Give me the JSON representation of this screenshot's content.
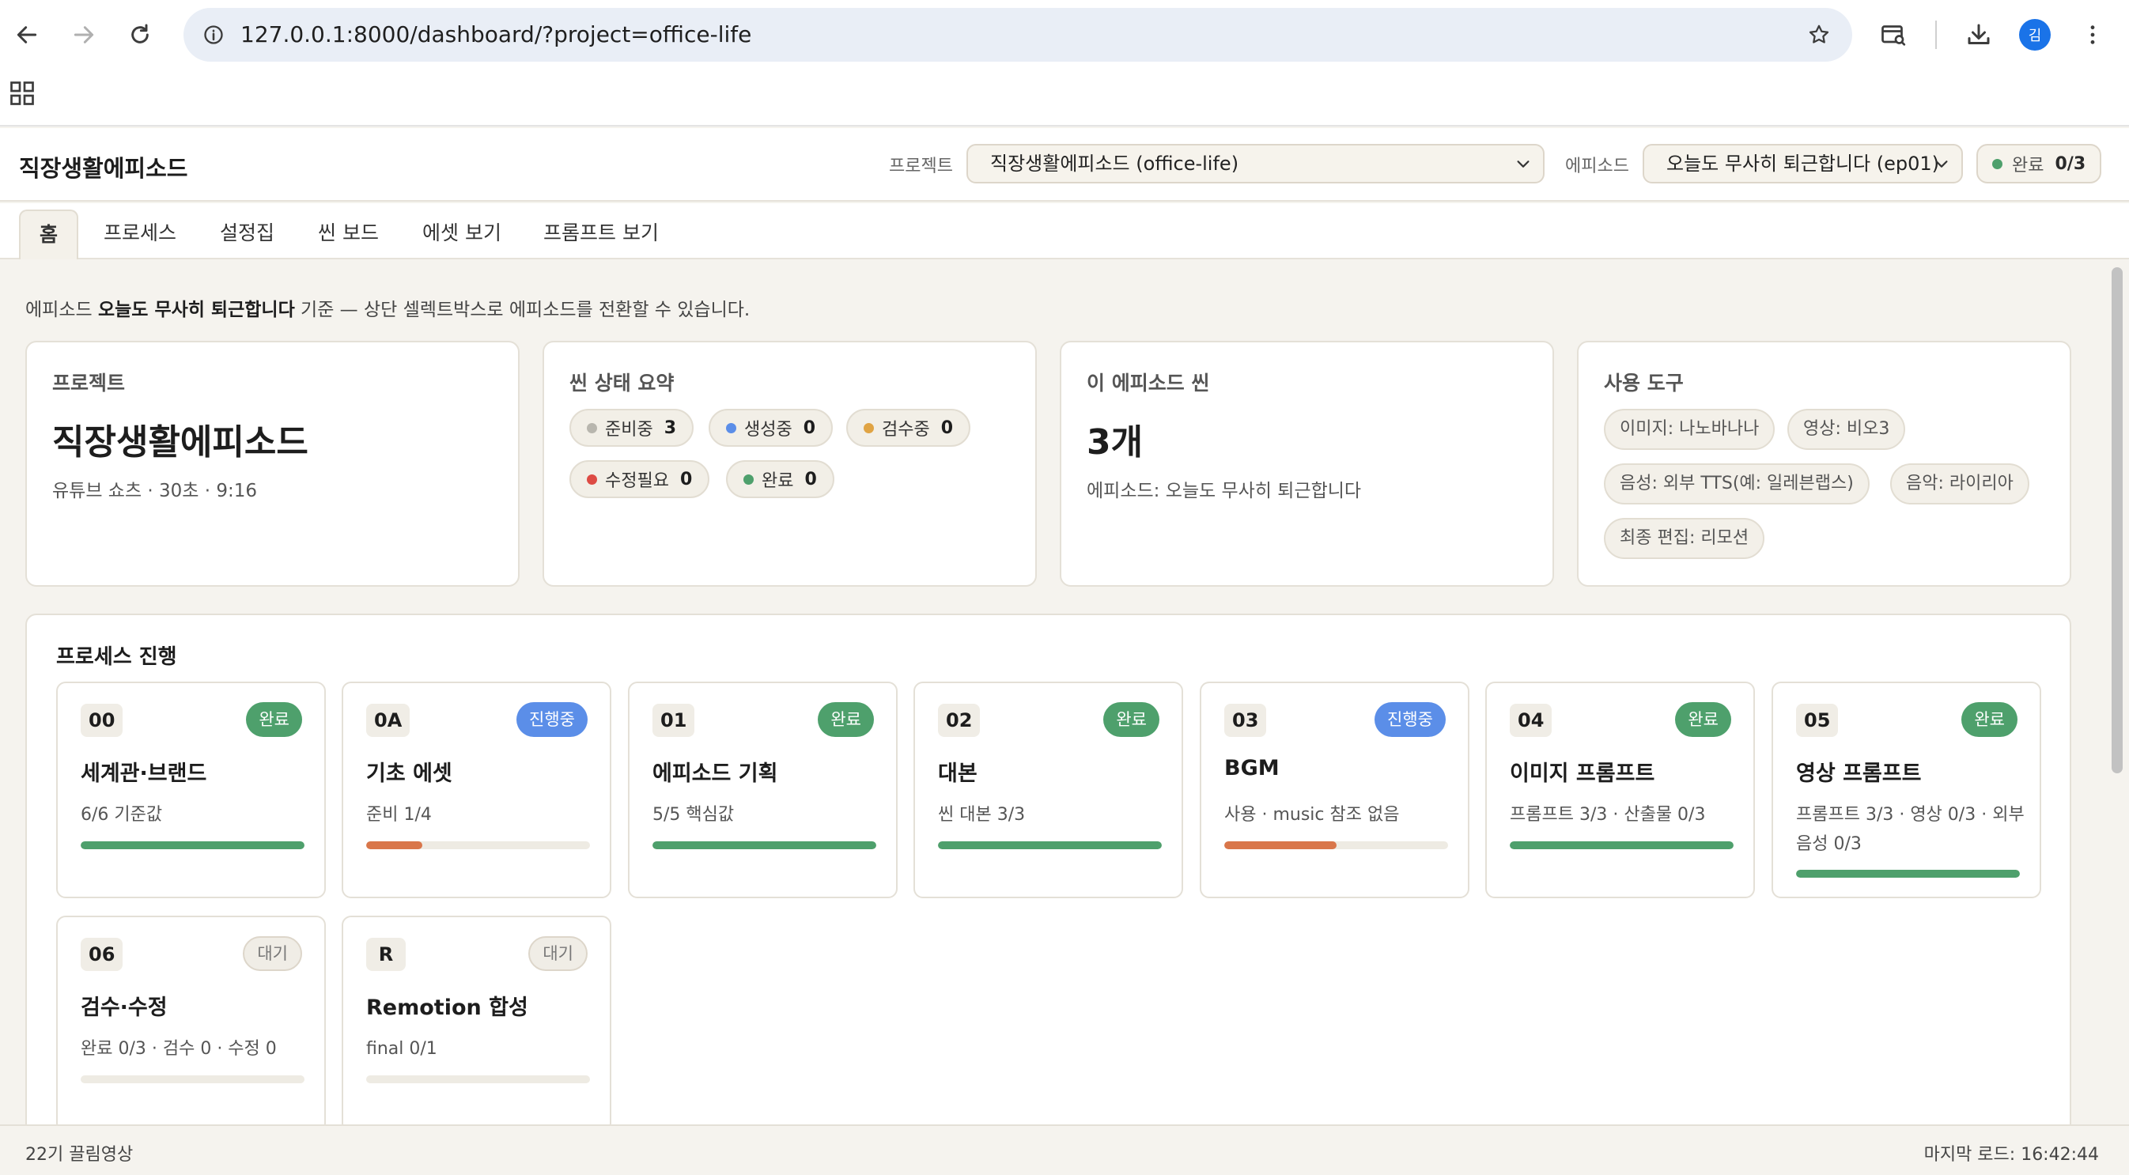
{
  "browser": {
    "url": "127.0.0.1:8000/dashboard/?project=office-life",
    "profile_initial": "김"
  },
  "header": {
    "brand": "직장생활에피소드",
    "project_label": "프로젝트",
    "project_value": "직장생활에피소드 (office-life)",
    "episode_label": "에피소드",
    "episode_value": "오늘도 무사히 퇴근합니다 (ep01)",
    "done_label": "완료",
    "done_value": "0/3"
  },
  "tabs": [
    "홈",
    "프로세스",
    "설정집",
    "씬 보드",
    "에셋 보기",
    "프롬프트 보기"
  ],
  "intro": {
    "prefix": "에피소드 ",
    "episode": "오늘도 무사히 퇴근합니다",
    "suffix": " 기준 — 상단 셀렉트박스로 에피소드를 전환할 수 있습니다."
  },
  "cards": {
    "project": {
      "title": "프로젝트",
      "name": "직장생활에피소드",
      "sub": "유튜브 쇼츠 · 30초 · 9:16"
    },
    "scene_status": {
      "title": "씬 상태 요약",
      "items": [
        {
          "label": "준비중",
          "count": "3",
          "color": "#b8b6ae"
        },
        {
          "label": "생성중",
          "count": "0",
          "color": "#5b8ee8"
        },
        {
          "label": "검수중",
          "count": "0",
          "color": "#e0a444"
        },
        {
          "label": "수정필요",
          "count": "0",
          "color": "#dd4b44"
        },
        {
          "label": "완료",
          "count": "0",
          "color": "#4ea06c"
        }
      ]
    },
    "episode_scenes": {
      "title": "이 에피소드 씬",
      "count": "3개",
      "sub": "에피소드: 오늘도 무사히 퇴근합니다"
    },
    "tools": {
      "title": "사용 도구",
      "items": [
        "이미지: 나노바나나",
        "영상: 비오3",
        "음성: 외부 TTS(예: 일레븐랩스)",
        "음악: 라이리아",
        "최종 편집: 리모션"
      ]
    }
  },
  "process": {
    "title": "프로세스 진행",
    "steps": [
      {
        "code": "00",
        "status": "완료",
        "state": "done",
        "name": "세계관·브랜드",
        "desc": "6/6 기준값",
        "progress": 1.0,
        "bar_color": "#4ea06c"
      },
      {
        "code": "0A",
        "status": "진행중",
        "state": "prog",
        "name": "기초 에셋",
        "desc": "준비 1/4",
        "progress": 0.25,
        "bar_color": "#d9764a"
      },
      {
        "code": "01",
        "status": "완료",
        "state": "done",
        "name": "에피소드 기획",
        "desc": "5/5 핵심값",
        "progress": 1.0,
        "bar_color": "#4ea06c"
      },
      {
        "code": "02",
        "status": "완료",
        "state": "done",
        "name": "대본",
        "desc": "씬 대본 3/3",
        "progress": 1.0,
        "bar_color": "#4ea06c"
      },
      {
        "code": "03",
        "status": "진행중",
        "state": "prog",
        "name": "BGM",
        "desc": "사용 · music 참조 없음",
        "progress": 0.5,
        "bar_color": "#d9764a"
      },
      {
        "code": "04",
        "status": "완료",
        "state": "done",
        "name": "이미지 프롬프트",
        "desc": "프롬프트 3/3 · 산출물 0/3",
        "progress": 1.0,
        "bar_color": "#4ea06c"
      },
      {
        "code": "05",
        "status": "완료",
        "state": "done",
        "name": "영상 프롬프트",
        "desc": "프롬프트 3/3 · 영상 0/3 · 외부 음성 0/3",
        "progress": 1.0,
        "bar_color": "#4ea06c"
      },
      {
        "code": "06",
        "status": "대기",
        "state": "wait",
        "name": "검수·수정",
        "desc": "완료 0/3 · 검수 0 · 수정 0",
        "progress": 0.0,
        "bar_color": "#4ea06c"
      },
      {
        "code": "R",
        "status": "대기",
        "state": "wait",
        "name": "Remotion 합성",
        "desc": "final 0/1",
        "progress": 0.0,
        "bar_color": "#4ea06c"
      }
    ]
  },
  "footer": {
    "left": "22기 끌림영상",
    "right": "마지막 로드: 16:42:44"
  }
}
